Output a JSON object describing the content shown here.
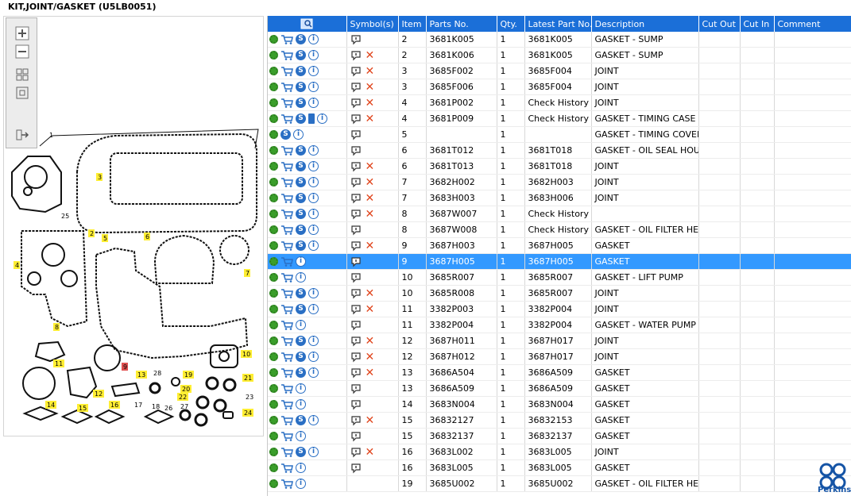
{
  "title": "KIT,JOINT/GASKET (U5LB0051)",
  "colors": {
    "header": "#1b6fd8",
    "selected": "#3399ff",
    "brand": "#1554a6"
  },
  "logo_text": "Perkins",
  "columns": [
    "",
    "Symbol(s)",
    "Item",
    "Parts No.",
    "Qty.",
    "Latest Part No.",
    "Description",
    "Cut Out",
    "Cut In",
    "Comment"
  ],
  "diagram_labels": [
    "1",
    "2",
    "3",
    "4",
    "5",
    "6",
    "7",
    "8",
    "9",
    "10",
    "11",
    "12",
    "13",
    "14",
    "15",
    "16",
    "17",
    "18",
    "19",
    "20",
    "21",
    "22",
    "23",
    "24",
    "25",
    "26",
    "27",
    "28"
  ],
  "rows": [
    {
      "item": "2",
      "part": "3681K005",
      "qty": "1",
      "latest": "3681K005",
      "desc": "GASKET - SUMP",
      "icons": [
        "gear",
        "cart",
        "s",
        "i"
      ],
      "sym": [
        "bubble"
      ]
    },
    {
      "item": "2",
      "part": "3681K006",
      "qty": "1",
      "latest": "3681K005",
      "desc": "GASKET - SUMP",
      "icons": [
        "gear",
        "cart",
        "s",
        "i"
      ],
      "sym": [
        "bubble",
        "x"
      ]
    },
    {
      "item": "3",
      "part": "3685F002",
      "qty": "1",
      "latest": "3685F004",
      "desc": "JOINT",
      "icons": [
        "gear",
        "cart",
        "s",
        "i"
      ],
      "sym": [
        "bubble",
        "x"
      ]
    },
    {
      "item": "3",
      "part": "3685F006",
      "qty": "1",
      "latest": "3685F004",
      "desc": "JOINT",
      "icons": [
        "gear",
        "cart",
        "s",
        "i"
      ],
      "sym": [
        "bubble",
        "x"
      ]
    },
    {
      "item": "4",
      "part": "3681P002",
      "qty": "1",
      "latest": "Check History",
      "desc": "JOINT",
      "icons": [
        "gear",
        "cart",
        "s",
        "i"
      ],
      "sym": [
        "bubble",
        "x"
      ]
    },
    {
      "item": "4",
      "part": "3681P009",
      "qty": "1",
      "latest": "Check History",
      "desc": "GASKET - TIMING CASE",
      "icons": [
        "gear",
        "cart",
        "s",
        "book",
        "i"
      ],
      "sym": [
        "bubble",
        "x"
      ]
    },
    {
      "item": "5",
      "part": "",
      "qty": "1",
      "latest": "",
      "desc": "GASKET - TIMING COVER",
      "icons": [
        "gear",
        "s",
        "i"
      ],
      "sym": [
        "bubble"
      ]
    },
    {
      "item": "6",
      "part": "3681T012",
      "qty": "1",
      "latest": "3681T018",
      "desc": "GASKET - OIL SEAL HOUSIN",
      "icons": [
        "gear",
        "cart",
        "s",
        "i"
      ],
      "sym": [
        "bubble"
      ]
    },
    {
      "item": "6",
      "part": "3681T013",
      "qty": "1",
      "latest": "3681T018",
      "desc": "JOINT",
      "icons": [
        "gear",
        "cart",
        "s",
        "i"
      ],
      "sym": [
        "bubble",
        "x"
      ]
    },
    {
      "item": "7",
      "part": "3682H002",
      "qty": "1",
      "latest": "3682H003",
      "desc": "JOINT",
      "icons": [
        "gear",
        "cart",
        "s",
        "i"
      ],
      "sym": [
        "bubble",
        "x"
      ]
    },
    {
      "item": "7",
      "part": "3683H003",
      "qty": "1",
      "latest": "3683H006",
      "desc": "JOINT",
      "icons": [
        "gear",
        "cart",
        "s",
        "i"
      ],
      "sym": [
        "bubble",
        "x"
      ]
    },
    {
      "item": "8",
      "part": "3687W007",
      "qty": "1",
      "latest": "Check History",
      "desc": "",
      "icons": [
        "gear",
        "cart",
        "s",
        "i"
      ],
      "sym": [
        "bubble",
        "x"
      ]
    },
    {
      "item": "8",
      "part": "3687W008",
      "qty": "1",
      "latest": "Check History",
      "desc": "GASKET - OIL FILTER HEAD",
      "icons": [
        "gear",
        "cart",
        "s",
        "i"
      ],
      "sym": [
        "bubble"
      ]
    },
    {
      "item": "9",
      "part": "3687H003",
      "qty": "1",
      "latest": "3687H005",
      "desc": "GASKET",
      "icons": [
        "gear",
        "cart",
        "s",
        "i"
      ],
      "sym": [
        "bubble",
        "x"
      ]
    },
    {
      "item": "9",
      "part": "3687H005",
      "qty": "1",
      "latest": "3687H005",
      "desc": "GASKET",
      "icons": [
        "gear",
        "cart",
        "i"
      ],
      "sym": [
        "bubble"
      ],
      "selected": true
    },
    {
      "item": "10",
      "part": "3685R007",
      "qty": "1",
      "latest": "3685R007",
      "desc": "GASKET - LIFT PUMP",
      "icons": [
        "gear",
        "cart",
        "i"
      ],
      "sym": [
        "bubble"
      ]
    },
    {
      "item": "10",
      "part": "3685R008",
      "qty": "1",
      "latest": "3685R007",
      "desc": "JOINT",
      "icons": [
        "gear",
        "cart",
        "s",
        "i"
      ],
      "sym": [
        "bubble",
        "x"
      ]
    },
    {
      "item": "11",
      "part": "3382P003",
      "qty": "1",
      "latest": "3382P004",
      "desc": "JOINT",
      "icons": [
        "gear",
        "cart",
        "s",
        "i"
      ],
      "sym": [
        "bubble",
        "x"
      ]
    },
    {
      "item": "11",
      "part": "3382P004",
      "qty": "1",
      "latest": "3382P004",
      "desc": "GASKET - WATER PUMP",
      "icons": [
        "gear",
        "cart",
        "i"
      ],
      "sym": [
        "bubble"
      ]
    },
    {
      "item": "12",
      "part": "3687H011",
      "qty": "1",
      "latest": "3687H017",
      "desc": "JOINT",
      "icons": [
        "gear",
        "cart",
        "s",
        "i"
      ],
      "sym": [
        "bubble",
        "x"
      ]
    },
    {
      "item": "12",
      "part": "3687H012",
      "qty": "1",
      "latest": "3687H017",
      "desc": "JOINT",
      "icons": [
        "gear",
        "cart",
        "s",
        "i"
      ],
      "sym": [
        "bubble",
        "x"
      ]
    },
    {
      "item": "13",
      "part": "3686A504",
      "qty": "1",
      "latest": "3686A509",
      "desc": "GASKET",
      "icons": [
        "gear",
        "cart",
        "s",
        "i"
      ],
      "sym": [
        "bubble",
        "x"
      ]
    },
    {
      "item": "13",
      "part": "3686A509",
      "qty": "1",
      "latest": "3686A509",
      "desc": "GASKET",
      "icons": [
        "gear",
        "cart",
        "i"
      ],
      "sym": [
        "bubble"
      ]
    },
    {
      "item": "14",
      "part": "3683N004",
      "qty": "1",
      "latest": "3683N004",
      "desc": "GASKET",
      "icons": [
        "gear",
        "cart",
        "i"
      ],
      "sym": [
        "bubble"
      ]
    },
    {
      "item": "15",
      "part": "36832127",
      "qty": "1",
      "latest": "36832153",
      "desc": "GASKET",
      "icons": [
        "gear",
        "cart",
        "s",
        "i"
      ],
      "sym": [
        "bubble",
        "x"
      ]
    },
    {
      "item": "15",
      "part": "36832137",
      "qty": "1",
      "latest": "36832137",
      "desc": "GASKET",
      "icons": [
        "gear",
        "cart",
        "i"
      ],
      "sym": [
        "bubble"
      ]
    },
    {
      "item": "16",
      "part": "3683L002",
      "qty": "1",
      "latest": "3683L005",
      "desc": "JOINT",
      "icons": [
        "gear",
        "cart",
        "s",
        "i"
      ],
      "sym": [
        "bubble",
        "x"
      ]
    },
    {
      "item": "16",
      "part": "3683L005",
      "qty": "1",
      "latest": "3683L005",
      "desc": "GASKET",
      "icons": [
        "gear",
        "cart",
        "i"
      ],
      "sym": [
        "bubble"
      ]
    },
    {
      "item": "19",
      "part": "3685U002",
      "qty": "1",
      "latest": "3685U002",
      "desc": "GASKET - OIL FILTER HEAD",
      "icons": [
        "gear",
        "cart",
        "i"
      ],
      "sym": []
    }
  ]
}
